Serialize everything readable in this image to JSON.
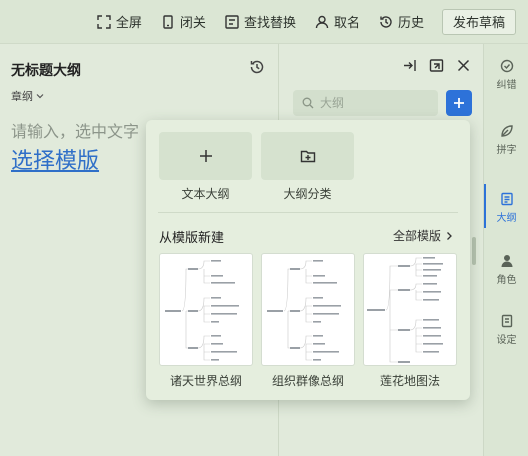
{
  "toolbar": {
    "fullscreen": "全屏",
    "close": "闭关",
    "find_replace": "查找替换",
    "naming": "取名",
    "history": "历史",
    "publish": "发布草稿"
  },
  "editor": {
    "title": "无标题大纲",
    "volume": "章纲",
    "placeholder": "请输入，选中文字",
    "pick_template": "选择模版"
  },
  "outline_panel": {
    "search_placeholder": "大纲"
  },
  "popup": {
    "cards": [
      {
        "label": "文本大纲",
        "icon": "plus-icon"
      },
      {
        "label": "大纲分类",
        "icon": "folder-plus-icon"
      }
    ],
    "section_title": "从模版新建",
    "all_templates": "全部模版",
    "templates": [
      {
        "label": "诸天世界总纲"
      },
      {
        "label": "组织群像总纲"
      },
      {
        "label": "莲花地图法"
      }
    ]
  },
  "sidebar": {
    "items": [
      {
        "label": "纠错",
        "icon": "correct-icon"
      },
      {
        "label": "拼字",
        "icon": "leaf-icon"
      },
      {
        "label": "大纲",
        "icon": "outline-icon",
        "active": true
      },
      {
        "label": "角色",
        "icon": "person-icon"
      },
      {
        "label": "设定",
        "icon": "settings-doc-icon"
      }
    ]
  },
  "colors": {
    "accent": "#2d72d9",
    "background": "#dfe9d8",
    "link": "#2f6fc8"
  }
}
